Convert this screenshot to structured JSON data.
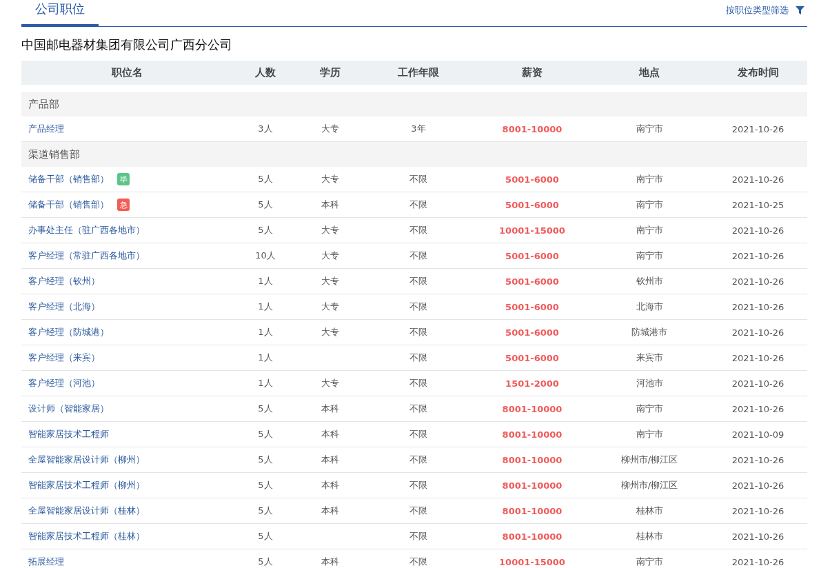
{
  "tabs": [
    {
      "label": "公司职位",
      "selected": true
    }
  ],
  "filter_link": "按职位类型筛选",
  "company": "中国邮电器材集团有限公司广西分公司",
  "table": {
    "columns": [
      "职位名",
      "人数",
      "学历",
      "工作年限",
      "薪资",
      "地点",
      "发布时间"
    ],
    "groups": [
      {
        "name": "产品部",
        "rows": [
          {
            "title": "产品经理",
            "count": "3人",
            "education": "大专",
            "experience": "3年",
            "salary": "8001-10000",
            "location": "南宁市",
            "date": "2021-10-26"
          }
        ]
      },
      {
        "name": "渠道销售部",
        "rows": [
          {
            "title": "储备干部（销售部）",
            "tag": {
              "text": "毕",
              "color": "#5cc586"
            },
            "count": "5人",
            "education": "大专",
            "experience": "不限",
            "salary": "5001-6000",
            "location": "南宁市",
            "date": "2021-10-26"
          },
          {
            "title": "储备干部（销售部）",
            "tag": {
              "text": "急",
              "color": "#f25c54"
            },
            "count": "5人",
            "education": "本科",
            "experience": "不限",
            "salary": "5001-6000",
            "location": "南宁市",
            "date": "2021-10-25"
          },
          {
            "title": "办事处主任（驻广西各地市）",
            "count": "5人",
            "education": "大专",
            "experience": "不限",
            "salary": "10001-15000",
            "location": "南宁市",
            "date": "2021-10-26"
          },
          {
            "title": "客户经理（常驻广西各地市）",
            "count": "10人",
            "education": "大专",
            "experience": "不限",
            "salary": "5001-6000",
            "location": "南宁市",
            "date": "2021-10-26"
          },
          {
            "title": "客户经理（钦州）",
            "count": "1人",
            "education": "大专",
            "experience": "不限",
            "salary": "5001-6000",
            "location": "钦州市",
            "date": "2021-10-26"
          },
          {
            "title": "客户经理（北海）",
            "count": "1人",
            "education": "大专",
            "experience": "不限",
            "salary": "5001-6000",
            "location": "北海市",
            "date": "2021-10-26"
          },
          {
            "title": "客户经理（防城港）",
            "count": "1人",
            "education": "大专",
            "experience": "不限",
            "salary": "5001-6000",
            "location": "防城港市",
            "date": "2021-10-26"
          },
          {
            "title": "客户经理（来宾）",
            "count": "1人",
            "experience": "不限",
            "salary": "5001-6000",
            "location": "来宾市",
            "date": "2021-10-26"
          },
          {
            "title": "客户经理（河池）",
            "count": "1人",
            "education": "大专",
            "experience": "不限",
            "salary": "1501-2000",
            "location": "河池市",
            "date": "2021-10-26"
          },
          {
            "title": "设计师（智能家居）",
            "count": "5人",
            "education": "本科",
            "experience": "不限",
            "salary": "8001-10000",
            "location": "南宁市",
            "date": "2021-10-26"
          },
          {
            "title": "智能家居技术工程师",
            "count": "5人",
            "education": "本科",
            "experience": "不限",
            "salary": "8001-10000",
            "location": "南宁市",
            "date": "2021-10-09"
          },
          {
            "title": "全屋智能家居设计师（柳州）",
            "count": "5人",
            "education": "本科",
            "experience": "不限",
            "salary": "8001-10000",
            "location": "柳州市/柳江区",
            "date": "2021-10-26"
          },
          {
            "title": "智能家居技术工程师（柳州）",
            "count": "5人",
            "education": "本科",
            "experience": "不限",
            "salary": "8001-10000",
            "location": "柳州市/柳江区",
            "date": "2021-10-26"
          },
          {
            "title": "全屋智能家居设计师（桂林）",
            "count": "5人",
            "education": "本科",
            "experience": "不限",
            "salary": "8001-10000",
            "location": "桂林市",
            "date": "2021-10-26"
          },
          {
            "title": "智能家居技术工程师（桂林）",
            "count": "5人",
            "experience": "不限",
            "salary": "8001-10000",
            "location": "桂林市",
            "date": "2021-10-26"
          },
          {
            "title": "拓展经理",
            "count": "5人",
            "education": "本科",
            "experience": "不限",
            "salary": "10001-15000",
            "location": "南宁市",
            "date": "2021-10-26"
          }
        ]
      }
    ]
  }
}
